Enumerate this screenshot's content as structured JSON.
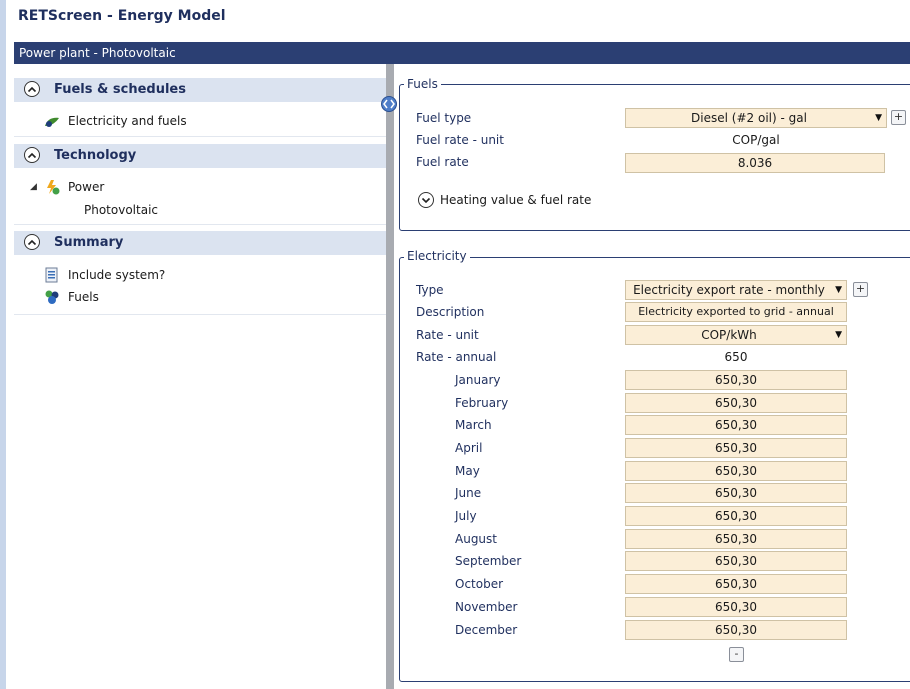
{
  "app": {
    "title": "RETScreen - Energy Model"
  },
  "window": {
    "title": "Power plant - Photovoltaic"
  },
  "nav": {
    "sections": [
      {
        "label": "Fuels & schedules"
      },
      {
        "label": "Technology"
      },
      {
        "label": "Summary"
      }
    ],
    "items": {
      "electricity_and_fuels": "Electricity and fuels",
      "power": "Power",
      "photovoltaic": "Photovoltaic",
      "include_system": "Include system?",
      "fuels": "Fuels"
    }
  },
  "fuels": {
    "group_title": "Fuels",
    "fuel_type_label": "Fuel type",
    "fuel_type_value": "Diesel (#2 oil) - gal",
    "fuel_rate_unit_label": "Fuel rate - unit",
    "fuel_rate_unit_value": "COP/gal",
    "fuel_rate_label": "Fuel rate",
    "fuel_rate_value": "8.036",
    "heating_value_label": "Heating value & fuel rate"
  },
  "electricity": {
    "group_title": "Electricity",
    "type_label": "Type",
    "type_value": "Electricity export rate - monthly",
    "description_label": "Description",
    "description_value": "Electricity exported to grid - annual",
    "rate_unit_label": "Rate - unit",
    "rate_unit_value": "COP/kWh",
    "rate_annual_label": "Rate - annual",
    "rate_annual_value": "650",
    "months": [
      {
        "name": "January",
        "value": "650,30"
      },
      {
        "name": "February",
        "value": "650,30"
      },
      {
        "name": "March",
        "value": "650,30"
      },
      {
        "name": "April",
        "value": "650,30"
      },
      {
        "name": "May",
        "value": "650,30"
      },
      {
        "name": "June",
        "value": "650,30"
      },
      {
        "name": "July",
        "value": "650,30"
      },
      {
        "name": "August",
        "value": "650,30"
      },
      {
        "name": "September",
        "value": "650,30"
      },
      {
        "name": "October",
        "value": "650,30"
      },
      {
        "name": "November",
        "value": "650,30"
      },
      {
        "name": "December",
        "value": "650,30"
      }
    ]
  },
  "glyphs": {
    "add": "+",
    "collapse": "-",
    "caret": "▼",
    "expander": "◢"
  },
  "colors": {
    "header": "#2b3f73",
    "section_bg": "#dbe3f0",
    "field_bg": "#fbeed7"
  }
}
